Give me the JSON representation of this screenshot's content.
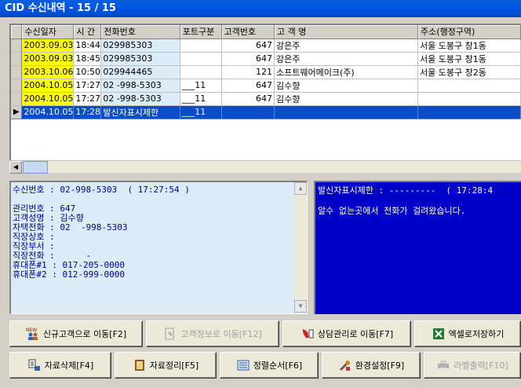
{
  "window": {
    "title": "CID 수신내역 - 15 / 15"
  },
  "grid": {
    "columns": [
      "수신일자",
      "시 간",
      "전화번호",
      "포트구분",
      "고객번호",
      "고 객 명",
      "주소(행정구역)"
    ],
    "rows": [
      {
        "date": "2003.09.03",
        "time": "18:44",
        "phone": "029985303",
        "port": "",
        "custno": "647",
        "name": "강은주",
        "addr": "서울 도봉구 창1동",
        "indicator": ""
      },
      {
        "date": "2003.09.03",
        "time": "18:45",
        "phone": "029985303",
        "port": "",
        "custno": "647",
        "name": "강은주",
        "addr": "서울 도봉구 창1동",
        "indicator": ""
      },
      {
        "date": "2003.10.06",
        "time": "10:50",
        "phone": "029944465",
        "port": "",
        "custno": "121",
        "name": "소프트웨어메이크(주)",
        "addr": "서울 도봉구 창2동",
        "indicator": ""
      },
      {
        "date": "2004.10.05",
        "time": "17:27",
        "phone": "02  -998-5303",
        "port": "___11",
        "custno": "647",
        "name": "김수향",
        "addr": "",
        "indicator": ""
      },
      {
        "date": "2004.10.05",
        "time": "17:27",
        "phone": "02  -998-5303",
        "port": "___11",
        "custno": "647",
        "name": "김수향",
        "addr": "",
        "indicator": ""
      },
      {
        "date": "2004.10.05",
        "time": "17:28",
        "phone": "발신자표시제한",
        "port": "___11",
        "custno": "",
        "name": "",
        "addr": "",
        "indicator": "▶"
      }
    ]
  },
  "info": {
    "lines": [
      "수신번호 : 02-998-5303  ( 17:27:54 )",
      "",
      "관리번호 : 647",
      "고객성명 : 김수향",
      "자택전화 : 02  -998-5303",
      "직장상호 :",
      "직장부서 :",
      "직장전화 :      -",
      "휴대폰#1 : 017-205-0000",
      "휴대폰#2 : 012-999-0000"
    ]
  },
  "message": {
    "lines": [
      "발신자표시제한 : ---------  ( 17:28:4",
      "",
      "알수 없는곳에서 전화가 걸려왔습니다."
    ]
  },
  "buttons": {
    "new_customer": "신규고객으로 이동[F2]",
    "customer_info": "고객정보로 이동[F12]",
    "consult": "상담관리로 이동[F7]",
    "excel": "엑셀로저장하기",
    "delete": "자료삭제[F4]",
    "organize": "자료정리[F5]",
    "sort": "정렬순서[F6]",
    "settings": "환경설정[F9]",
    "label_print": "라벨출력[F10]",
    "new_badge": "NEW"
  },
  "colors": {
    "title_bar": "#0058e6",
    "date_highlight": "#ffff00",
    "selected_row": "#0a4dc8",
    "message_bg": "#0000c8",
    "info_bg": "#dcebf8"
  }
}
